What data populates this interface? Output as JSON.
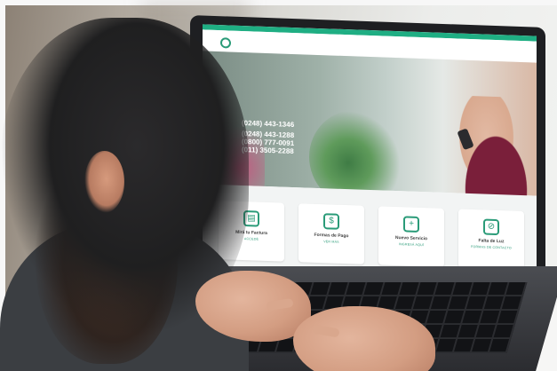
{
  "site": {
    "topbar_text": "",
    "brand": "",
    "menu": [
      "",
      "",
      "",
      "",
      "",
      ""
    ],
    "hero": {
      "phone_label_1": "",
      "phone_1": "(0248) 443-1346",
      "phone_label_2": "",
      "phones": [
        "(0248) 443-1288",
        "(0800) 777-0091",
        "(011) 3505-2288"
      ],
      "cta": ""
    },
    "cards": [
      {
        "icon": "document-icon",
        "title": "Mirá tu Factura",
        "subtitle": "ACCEDÉ"
      },
      {
        "icon": "hand-coin-icon",
        "title": "Formas de Pago",
        "subtitle": "VER MÁS"
      },
      {
        "icon": "new-service-icon",
        "title": "Nuevo Servicio",
        "subtitle": "INGRESÁ AQUÍ"
      },
      {
        "icon": "no-power-icon",
        "title": "Falta de Luz",
        "subtitle": "FORMAS DE CONTACTO"
      }
    ]
  },
  "colors": {
    "accent": "#1fae83",
    "cta": "#e64b55"
  }
}
